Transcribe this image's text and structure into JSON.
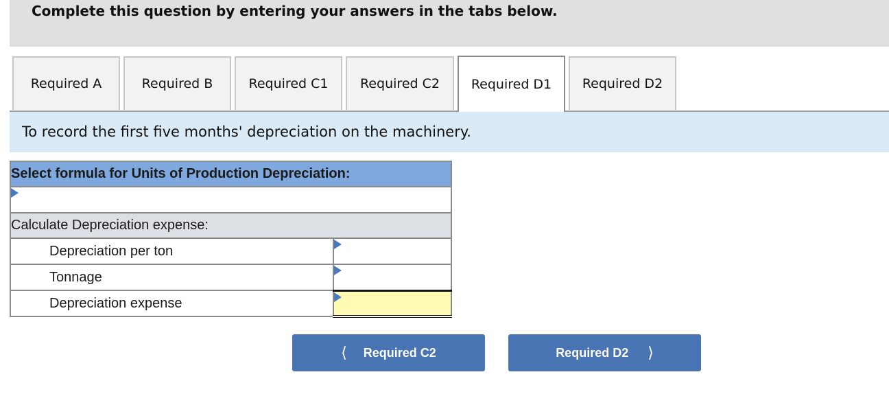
{
  "header": {
    "title": "Complete this question by entering your answers in the tabs below."
  },
  "tabs": [
    {
      "label": "Required A",
      "active": false
    },
    {
      "label": "Required B",
      "active": false
    },
    {
      "label": "Required C1",
      "active": false
    },
    {
      "label": "Required C2",
      "active": false
    },
    {
      "label": "Required D1",
      "active": true
    },
    {
      "label": "Required D2",
      "active": false
    }
  ],
  "instruction": "To record the first five months' depreciation on the machinery.",
  "worksheet": {
    "formula_header": "Select formula for Units of Production Depreciation:",
    "formula_value": "",
    "calc_header": "Calculate Depreciation expense:",
    "rows": [
      {
        "label": "Depreciation per ton",
        "value": ""
      },
      {
        "label": "Tonnage",
        "value": ""
      },
      {
        "label": "Depreciation expense",
        "value": ""
      }
    ]
  },
  "nav": {
    "prev_label": "Required C2",
    "next_label": "Required D2",
    "prev_icon": "chevron-left-icon",
    "next_icon": "chevron-right-icon"
  },
  "colors": {
    "header_bg": "#e0e0e0",
    "instruction_bg": "#dbeaf7",
    "table_header_bg": "#7ea8de",
    "total_cell_bg": "#fffbb5",
    "button_bg": "#4874b3"
  }
}
